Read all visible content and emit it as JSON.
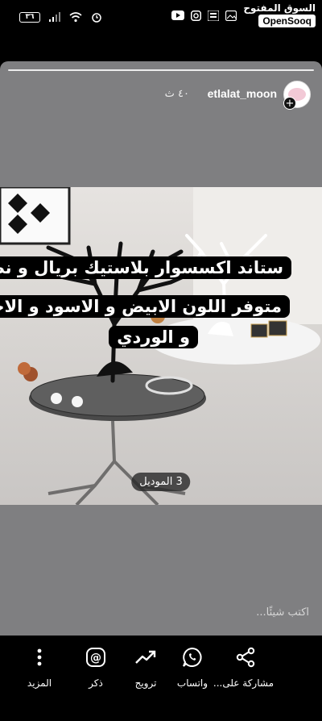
{
  "status_bar": {
    "battery": "٣٦",
    "brand_arabic": "السوق المفتوح",
    "brand_english": "OpenSooq"
  },
  "story": {
    "username": "etlalat_moon",
    "time_ago": "٤٠ ث",
    "caption_line1": "ستاند اكسسوار بلاستيك بريال و نص",
    "caption_line2": "متوفر اللون الابيض و الاسود و الاحمر",
    "caption_line3": "و الوردي",
    "model_label": "3 الموديل",
    "reply_placeholder": "اكتب شيئًا..."
  },
  "actions": [
    {
      "label": "المزيد",
      "icon": "more-vertical-icon"
    },
    {
      "label": "ذكر",
      "icon": "mention-icon"
    },
    {
      "label": "ترويج",
      "icon": "trending-icon"
    },
    {
      "label": "واتساب",
      "icon": "whatsapp-icon"
    },
    {
      "label": "مشاركة على...",
      "icon": "share-icon"
    }
  ]
}
